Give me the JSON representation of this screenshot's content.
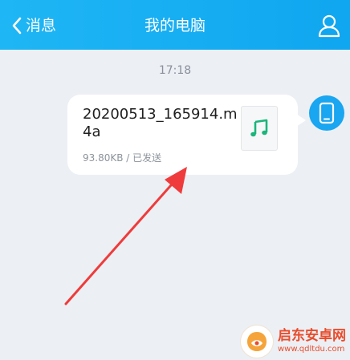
{
  "header": {
    "back_label": "消息",
    "title": "我的电脑"
  },
  "chat": {
    "timestamp": "17:18",
    "message": {
      "filename": "20200513_165914.m4a",
      "size": "93.80KB",
      "separator": " / ",
      "status": "已发送"
    }
  },
  "watermark": {
    "name": "启东安卓网",
    "url": "www.qdltdu.com"
  },
  "colors": {
    "header_bg": "#10a6f0",
    "music_icon": "#1bb57b",
    "annotation_arrow": "#ef3b3b"
  }
}
